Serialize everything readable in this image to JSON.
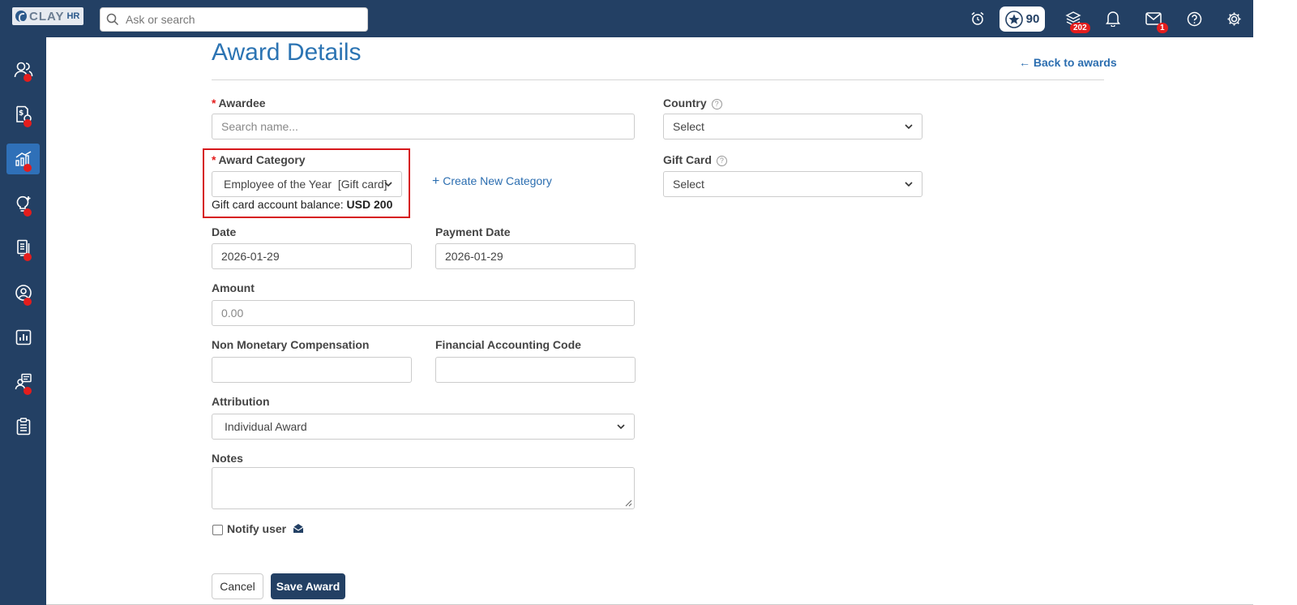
{
  "header": {
    "logo_text": "CLAY",
    "logo_suffix": "HR",
    "search_placeholder": "Ask or search",
    "points": "90",
    "layers_badge": "202",
    "mail_badge": "1"
  },
  "page": {
    "title": "Award Details",
    "back_link": "Back to awards"
  },
  "form": {
    "awardee": {
      "label": "Awardee",
      "placeholder": "Search name..."
    },
    "award_category": {
      "label": "Award Category",
      "value": "Employee of the Year  [Gift card]"
    },
    "balance": {
      "label": "Gift card account balance:",
      "value": "USD 200"
    },
    "create_category": "Create New Category",
    "country": {
      "label": "Country",
      "value": "Select"
    },
    "gift_card": {
      "label": "Gift Card",
      "value": "Select"
    },
    "date": {
      "label": "Date",
      "value": "2026-01-29"
    },
    "payment_date": {
      "label": "Payment Date",
      "value": "2026-01-29"
    },
    "amount": {
      "label": "Amount",
      "placeholder": "0.00"
    },
    "non_monetary": {
      "label": "Non Monetary Compensation",
      "value": ""
    },
    "accounting_code": {
      "label": "Financial Accounting Code",
      "value": ""
    },
    "attribution": {
      "label": "Attribution",
      "value": "Individual Award"
    },
    "notes": {
      "label": "Notes",
      "value": ""
    },
    "notify_user": "Notify user",
    "cancel": "Cancel",
    "save": "Save Award"
  },
  "colors": {
    "navy": "#234064",
    "accent_blue": "#2c74b3",
    "active_blue": "#2f70b8",
    "alert_red": "#e41d1d"
  }
}
